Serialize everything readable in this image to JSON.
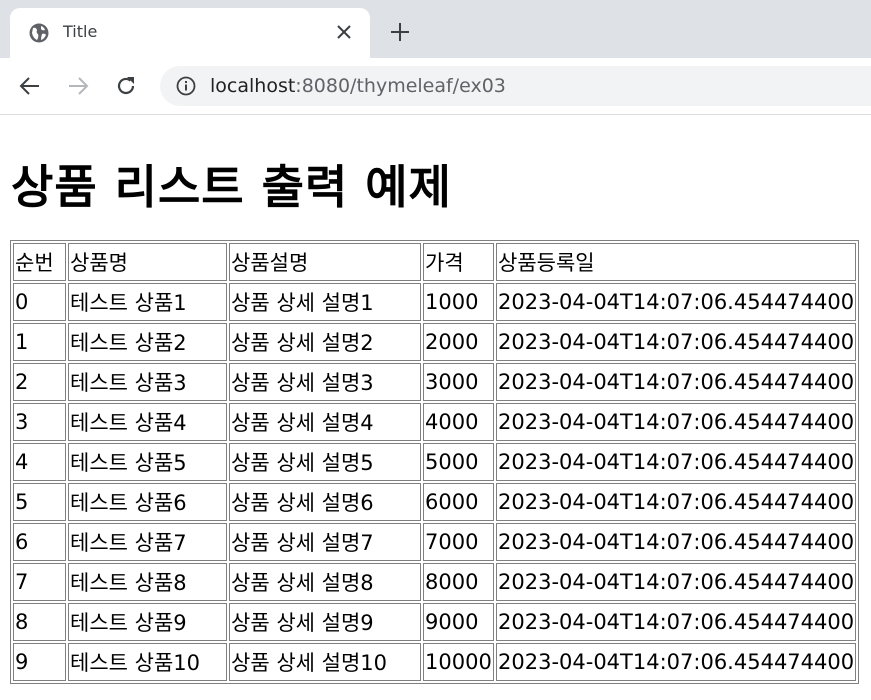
{
  "browser": {
    "tab_title": "Title",
    "url_host": "localhost",
    "url_rest": ":8080/thymeleaf/ex03"
  },
  "page": {
    "heading": "상품 리스트 출력 예제"
  },
  "table": {
    "headers": [
      "순번",
      "상품명",
      "상품설명",
      "가격",
      "상품등록일"
    ],
    "rows": [
      [
        "0",
        "테스트 상품1",
        "상품 상세 설명1",
        "1000",
        "2023-04-04T14:07:06.454474400"
      ],
      [
        "1",
        "테스트 상품2",
        "상품 상세 설명2",
        "2000",
        "2023-04-04T14:07:06.454474400"
      ],
      [
        "2",
        "테스트 상품3",
        "상품 상세 설명3",
        "3000",
        "2023-04-04T14:07:06.454474400"
      ],
      [
        "3",
        "테스트 상품4",
        "상품 상세 설명4",
        "4000",
        "2023-04-04T14:07:06.454474400"
      ],
      [
        "4",
        "테스트 상품5",
        "상품 상세 설명5",
        "5000",
        "2023-04-04T14:07:06.454474400"
      ],
      [
        "5",
        "테스트 상품6",
        "상품 상세 설명6",
        "6000",
        "2023-04-04T14:07:06.454474400"
      ],
      [
        "6",
        "테스트 상품7",
        "상품 상세 설명7",
        "7000",
        "2023-04-04T14:07:06.454474400"
      ],
      [
        "7",
        "테스트 상품8",
        "상품 상세 설명8",
        "8000",
        "2023-04-04T14:07:06.454474400"
      ],
      [
        "8",
        "테스트 상품9",
        "상품 상세 설명9",
        "9000",
        "2023-04-04T14:07:06.454474400"
      ],
      [
        "9",
        "테스트 상품10",
        "상품 상세 설명10",
        "10000",
        "2023-04-04T14:07:06.454474400"
      ]
    ]
  },
  "icons": {
    "tab_favicon": "globe-icon",
    "tab_close": "close-icon",
    "new_tab": "plus-icon",
    "back": "back-arrow-icon",
    "forward": "forward-arrow-icon",
    "reload": "reload-icon",
    "site_info": "info-icon"
  }
}
